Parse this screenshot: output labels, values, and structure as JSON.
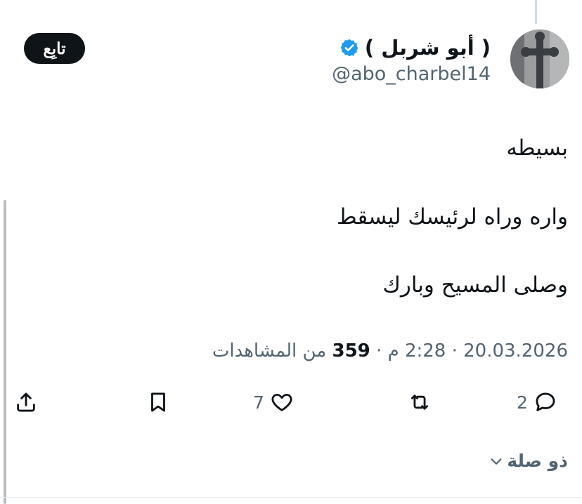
{
  "author": {
    "display_name": "( أبو شربل )",
    "handle": "@abo_charbel14",
    "avatar_icon": "cross-avatar",
    "verified_icon": "verified-badge-icon",
    "verified_color": "#1d9bf0"
  },
  "follow_button": {
    "label": "تابِع"
  },
  "tweet": {
    "lines": [
      "بسيطه",
      "واره وراه لرئيسك ليسقط",
      "وصلى المسيح وبارك"
    ]
  },
  "meta": {
    "date": "20.03.2026",
    "separator": "·",
    "time": "2:28 م",
    "views_count": "359",
    "views_label": "من المشاهدات"
  },
  "actions": {
    "reply": {
      "icon": "reply-icon",
      "count": "2"
    },
    "retweet": {
      "icon": "retweet-icon",
      "count": ""
    },
    "like": {
      "icon": "heart-icon",
      "count": "7"
    },
    "bookmark": {
      "icon": "bookmark-icon"
    },
    "share": {
      "icon": "share-icon"
    }
  },
  "related": {
    "label": "ذو صلة",
    "icon": "chevron-down-icon"
  },
  "colors": {
    "text": "#0f1419",
    "secondary": "#536471",
    "button_bg": "#0f1419"
  }
}
